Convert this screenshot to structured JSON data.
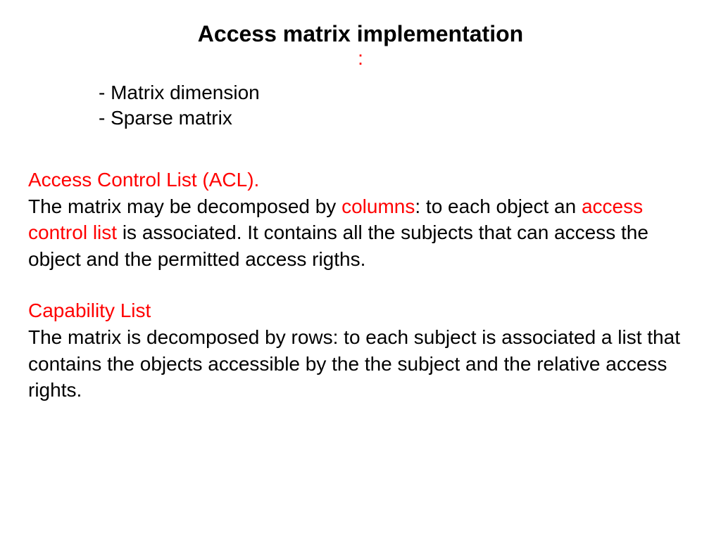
{
  "title": "Access matrix implementation",
  "colon": ":",
  "bullets": {
    "item1": "- Matrix dimension",
    "item2": "- Sparse matrix"
  },
  "acl": {
    "heading": "Access Control List (ACL).",
    "text1": "The matrix may be decomposed by ",
    "highlight1": "columns",
    "text2": ": to each object an ",
    "highlight2": "access control list",
    "text3": " is associated. It contains all the subjects that can access the object and the permitted access rigths."
  },
  "capability": {
    "heading": "Capability List",
    "text": "The matrix is decomposed by rows: to each subject  is associated a list that contains the objects accessible  by the the subject and the relative access rights."
  }
}
